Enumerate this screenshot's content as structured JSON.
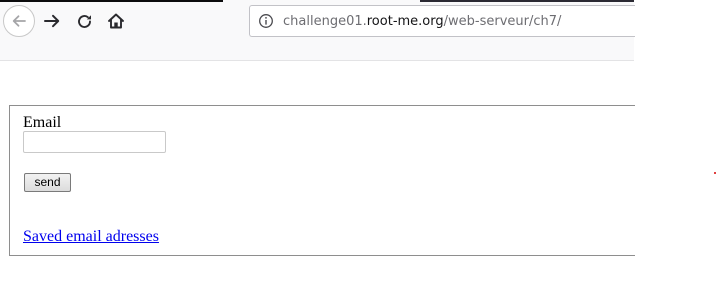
{
  "browser": {
    "back_icon": "arrow-left-icon",
    "forward_icon": "arrow-right-icon",
    "reload_icon": "reload-icon",
    "home_icon": "home-icon",
    "url": {
      "info_icon": "info-circle-icon",
      "host_prefix": "challenge01.",
      "domain": "root-me.org",
      "path": "/web-serveur/ch7/"
    }
  },
  "form": {
    "email_label": "Email",
    "email_value": "",
    "send_label": "send",
    "saved_link_text": "Saved email adresses"
  },
  "colors": {
    "link": "#0000ee",
    "frame_border": "#8e8e8e",
    "toolbar_bg": "#f9f9fa"
  }
}
